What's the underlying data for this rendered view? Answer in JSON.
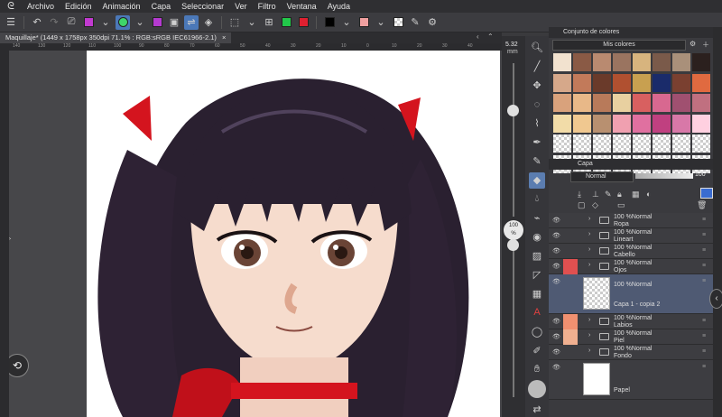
{
  "menu": [
    "Archivo",
    "Edición",
    "Animación",
    "Capa",
    "Seleccionar",
    "Ver",
    "Filtro",
    "Ventana",
    "Ayuda"
  ],
  "tab": {
    "title": "Maquillaje* (1449 x 1758px 350dpi 71.1% : RGB:sRGB IEC61966-2.1)",
    "close": "×"
  },
  "ruler_ticks": [
    "140",
    "130",
    "120",
    "110",
    "100",
    "90",
    "80",
    "70",
    "60",
    "50",
    "40",
    "30",
    "20",
    "10",
    "0",
    "10",
    "20",
    "30",
    "40"
  ],
  "brush_size": {
    "value": "5.32",
    "unit": "mm",
    "zoom": "100",
    "zoom_unit": "%"
  },
  "color_set": {
    "title": "Conjunto de colores",
    "selected": "Mis colores",
    "swatches": [
      "#f2e2cf",
      "#8a5a45",
      "#b98a70",
      "#9a7460",
      "#d7b47e",
      "#7a5a4a",
      "#a9907a",
      "#2b201e",
      "#d6a88a",
      "#c27a5a",
      "#6a3a2a",
      "#b05030",
      "#c8a050",
      "#1a2b6a",
      "#7a4030",
      "#e06a40",
      "#d9a27c",
      "#e8b888",
      "#b87a5a",
      "#e8d0a0",
      "#d86060",
      "#d86890",
      "#a05070",
      "#c07080",
      "#f2dca8",
      "#f0c890",
      "#b89070",
      "#f0a0b0",
      "#e070a0",
      "#c04080",
      "#d878a8",
      "#ffd0e0"
    ]
  },
  "layer_panel": {
    "title": "Capa",
    "blend_mode": "Normal",
    "opacity": "100",
    "layers": [
      {
        "mode": "100 %Normal",
        "name": "Ropa",
        "type": "folder"
      },
      {
        "mode": "100 %Normal",
        "name": "Lineart",
        "type": "folder"
      },
      {
        "mode": "100 %Normal",
        "name": "Cabello",
        "type": "folder"
      },
      {
        "mode": "100 %Normal",
        "name": "Ojos",
        "type": "folder"
      },
      {
        "mode": "100 %Normal",
        "name": "Capa 1 - copia 2",
        "type": "raster",
        "selected": true
      },
      {
        "mode": "100 %Normal",
        "name": "Labios",
        "type": "folder"
      },
      {
        "mode": "100 %Normal",
        "name": "Piel",
        "type": "folder"
      },
      {
        "mode": "100 %Normal",
        "name": "Fondo",
        "type": "folder"
      },
      {
        "mode": "",
        "name": "Papel",
        "type": "paper"
      }
    ]
  },
  "colors": {
    "accent": "#4b78b8",
    "selected_layer": "#4f5a73",
    "ribbon": "#d4141e",
    "hair": "#2a2030",
    "skin": "#f6dccd"
  }
}
